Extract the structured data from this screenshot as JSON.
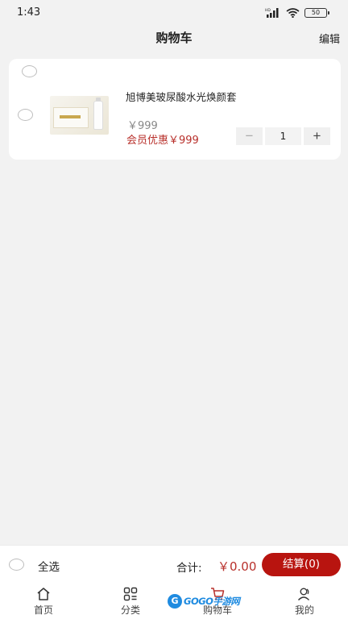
{
  "status_bar": {
    "time": "1:43",
    "hd": "HD",
    "battery": "50"
  },
  "navbar": {
    "title": "购物车",
    "edit_label": "编辑"
  },
  "cart": {
    "item": {
      "name": "旭博美玻尿酸水光焕颜套",
      "price": "￥999",
      "member_price": "会员优惠￥999",
      "quantity": "1",
      "minus_label": "−",
      "plus_label": "+"
    }
  },
  "bottom_bar": {
    "select_all_label": "全选",
    "total_label": "合计:",
    "total_value": "￥0.00",
    "checkout_label": "结算(0)"
  },
  "tabbar": {
    "tabs": [
      {
        "label": "首页",
        "icon": "home-icon"
      },
      {
        "label": "分类",
        "icon": "category-grid-icon"
      },
      {
        "label": "购物车",
        "icon": "cart-icon"
      },
      {
        "label": "我的",
        "icon": "profile-icon"
      }
    ]
  },
  "watermark": {
    "badge": "G",
    "text": "GOGO手游网"
  },
  "colors": {
    "accent": "#b8140f",
    "price_red": "#b8302b",
    "background": "#f2f2f2"
  }
}
